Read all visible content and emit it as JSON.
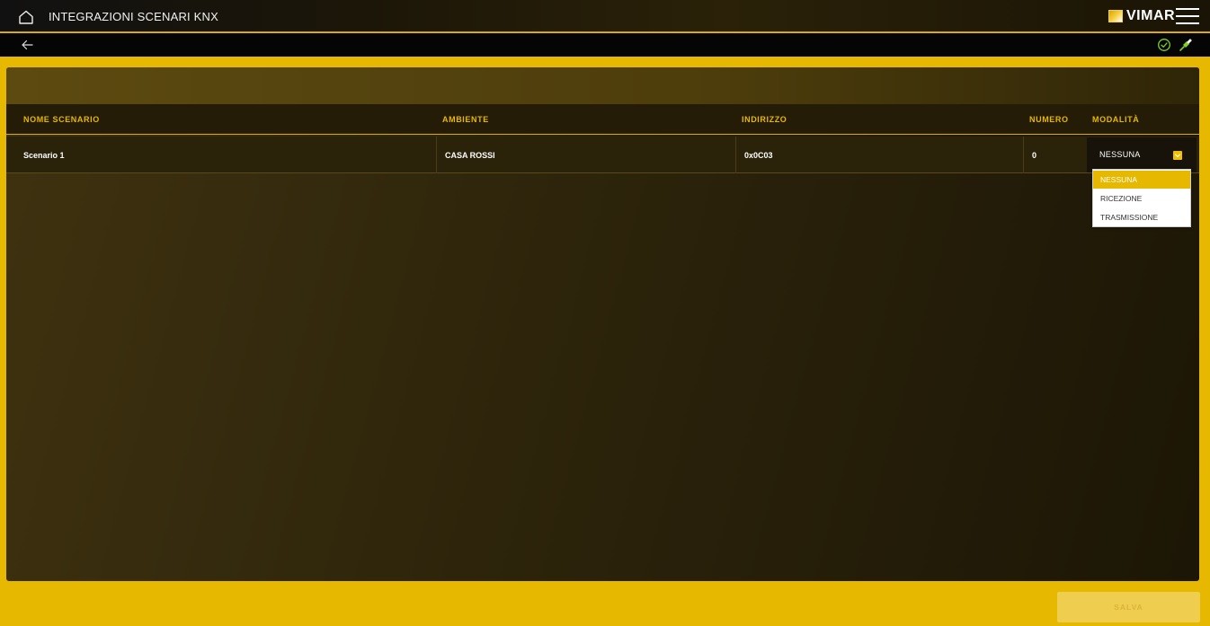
{
  "header": {
    "title": "INTEGRAZIONI SCENARI KNX",
    "brand": "VIMAR",
    "home_icon": "home-icon",
    "menu_icon": "hamburger-menu-icon"
  },
  "subbar": {
    "back_icon": "arrow-left-icon",
    "status_icon": "check-circle-icon",
    "connection_icon": "plug-icon",
    "status_color": "#7ed321"
  },
  "table": {
    "columns": [
      "NOME SCENARIO",
      "AMBIENTE",
      "INDIRIZZO",
      "NUMERO",
      "MODALITÀ"
    ],
    "rows": [
      {
        "nome_scenario": "Scenario 1",
        "ambiente": "CASA ROSSI",
        "indirizzo": "0x0C03",
        "numero": "0",
        "modalita": "NESSUNA"
      }
    ]
  },
  "mode_dropdown": {
    "options": [
      "NESSUNA",
      "RICEZIONE",
      "TRASMISSIONE"
    ],
    "selected": "NESSUNA"
  },
  "actions": {
    "save_label": "SALVA"
  },
  "colors": {
    "accent": "#e6b800",
    "background_dark": "#2d240b"
  }
}
